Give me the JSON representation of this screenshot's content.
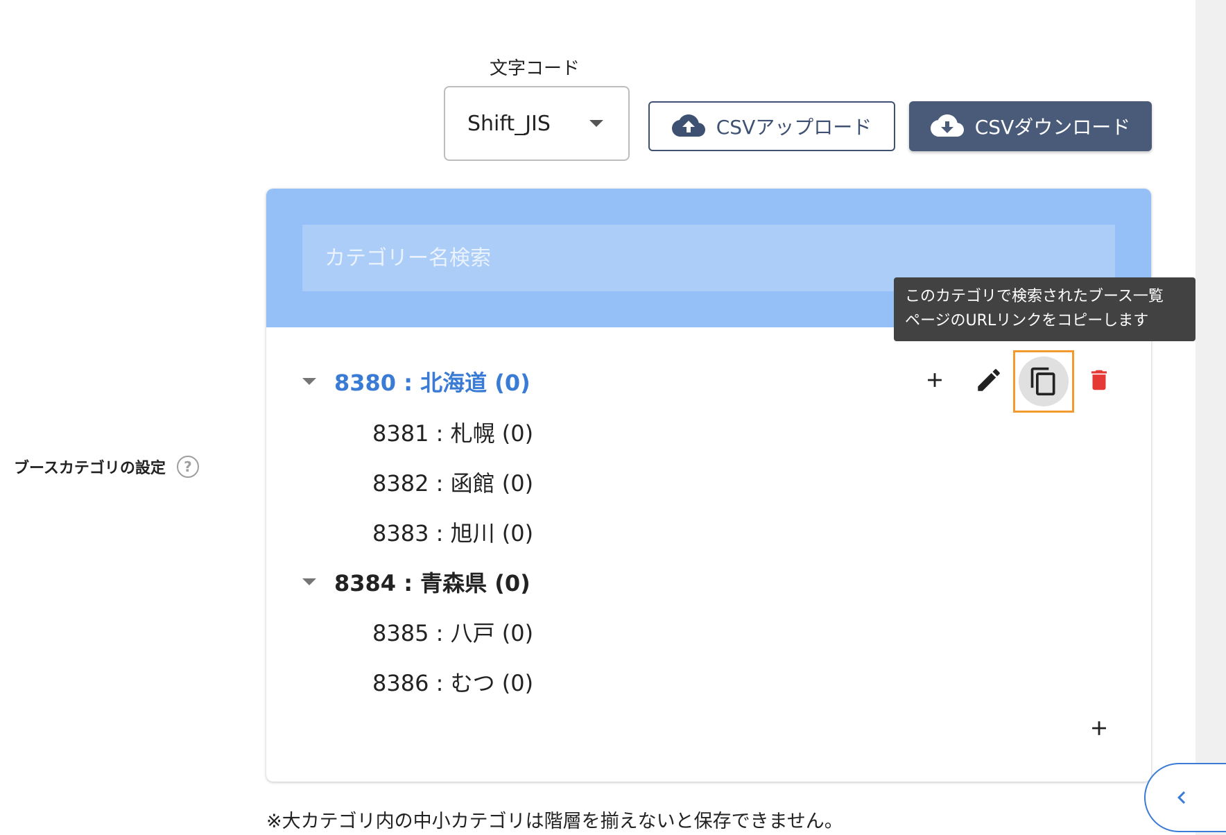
{
  "encoding": {
    "label": "文字コード",
    "selected": "Shift_JIS"
  },
  "csv": {
    "upload_label": "CSVアップロード",
    "download_label": "CSVダウンロード"
  },
  "search": {
    "placeholder": "カテゴリー名検索"
  },
  "tooltip": {
    "line1": "このカテゴリで検索されたブース一覧",
    "line2": "ページのURLリンクをコピーします"
  },
  "tree": {
    "groups": [
      {
        "label": "8380 : 北海道 (0)",
        "active": true,
        "children": [
          {
            "label": "8381 : 札幌 (0)"
          },
          {
            "label": "8382 : 函館 (0)"
          },
          {
            "label": "8383 : 旭川 (0)"
          }
        ]
      },
      {
        "label": "8384 : 青森県 (0)",
        "active": false,
        "children": [
          {
            "label": "8385 : 八戸 (0)"
          },
          {
            "label": "8386 : むつ (0)"
          }
        ]
      }
    ]
  },
  "section": {
    "label": "ブースカテゴリの設定",
    "help": "?"
  },
  "note": "※大カテゴリ内の中小カテゴリは階層を揃えないと保存できません。",
  "colors": {
    "accent": "#3a7bd5",
    "panel_header": "#94bff7",
    "button_dark": "#4a5b7a",
    "delete": "#e53935",
    "highlight": "#f29a2e"
  }
}
